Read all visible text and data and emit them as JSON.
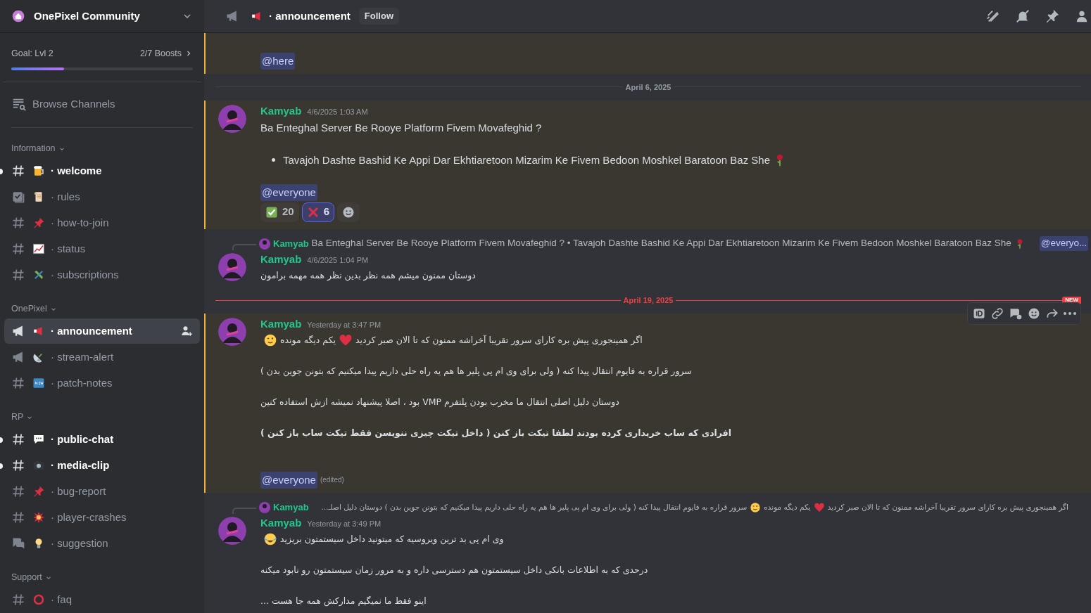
{
  "server": {
    "name": "OnePixel Community"
  },
  "boost": {
    "goal": "Goal: Lvl 2",
    "count": "2/7 Boosts",
    "level": 0.29
  },
  "browse": "Browse Channels",
  "categories": [
    {
      "name": "Information",
      "channels": [
        {
          "name": "· welcome",
          "kind": "text",
          "emoji": {
            "kind": "beer"
          },
          "unread": true,
          "selected": false
        },
        {
          "name": "· rules",
          "kind": "rules",
          "emoji": {
            "kind": "scroll"
          },
          "unread": false,
          "selected": false
        },
        {
          "name": "· how-to-join",
          "kind": "text",
          "emoji": {
            "kind": "pin"
          },
          "unread": false,
          "selected": false
        },
        {
          "name": "· status",
          "kind": "text",
          "emoji": {
            "kind": "chart"
          },
          "unread": false,
          "selected": false
        },
        {
          "name": "· subscriptions",
          "kind": "text",
          "emoji": {
            "kind": "tools"
          },
          "unread": false,
          "selected": false
        }
      ]
    },
    {
      "name": "OnePixel",
      "channels": [
        {
          "name": "· announcement",
          "kind": "announcement",
          "emoji": {
            "kind": "megaphone"
          },
          "unread": true,
          "selected": true
        },
        {
          "name": "· stream-alert",
          "kind": "announcement",
          "emoji": {
            "kind": "satellite"
          },
          "unread": false,
          "selected": false
        },
        {
          "name": "· patch-notes",
          "kind": "text",
          "emoji": {
            "kind": "new"
          },
          "unread": false,
          "selected": false
        }
      ]
    },
    {
      "name": "RP",
      "channels": [
        {
          "name": "· public-chat",
          "kind": "text",
          "emoji": {
            "kind": "speech"
          },
          "unread": true,
          "selected": false
        },
        {
          "name": "· media-clip",
          "kind": "text",
          "emoji": {
            "kind": "camera"
          },
          "unread": true,
          "selected": false
        },
        {
          "name": "· bug-report",
          "kind": "text",
          "emoji": {
            "kind": "pin"
          },
          "unread": false,
          "selected": false
        },
        {
          "name": "· player-crashes",
          "kind": "text",
          "emoji": {
            "kind": "boom"
          },
          "unread": false,
          "selected": false
        },
        {
          "name": "· suggestion",
          "kind": "forum",
          "emoji": {
            "kind": "bulb"
          },
          "unread": false,
          "selected": false
        }
      ]
    },
    {
      "name": "Support",
      "channels": [
        {
          "name": "· faq",
          "kind": "text",
          "emoji": {
            "kind": "ring"
          },
          "unread": false,
          "selected": false
        }
      ]
    }
  ],
  "header": {
    "channel": "· announcement",
    "kind": "announcement",
    "emoji": {
      "kind": "megaphone"
    },
    "follow": "Follow"
  },
  "feed": [
    {
      "kind": "message",
      "highlighted": true,
      "lines": [
        {
          "kind": "mention",
          "text": "@here"
        }
      ]
    },
    {
      "kind": "divider",
      "date": "April 6, 2025",
      "new": false
    },
    {
      "kind": "message",
      "highlighted": true,
      "author": "Kamyab",
      "time": "4/6/2025 1:03 AM",
      "lines": [
        {
          "kind": "text",
          "parts": [
            {
              "kind": "text",
              "text": "Ba Enteghal Server Be Rooye Platform Fivem Movafeghid ?"
            }
          ]
        },
        {
          "kind": "blank"
        },
        {
          "kind": "bullet",
          "parts": [
            {
              "kind": "text",
              "text": "Tavajoh Dashte Bashid Ke Appi Dar Ekhtiaretoon Mizarim Ke Fivem Bedoon Moshkel Baratoon Baz She"
            },
            {
              "kind": "rose"
            }
          ]
        },
        {
          "kind": "blank"
        },
        {
          "kind": "mention",
          "text": "@everyone"
        }
      ],
      "reactions": [
        {
          "emoji": {
            "kind": "check"
          },
          "count": "20",
          "selected": false
        },
        {
          "emoji": {
            "kind": "cross"
          },
          "count": "6",
          "selected": true
        }
      ]
    },
    {
      "kind": "message",
      "highlighted": false,
      "author": "Kamyab",
      "time": "4/6/2025 1:04 PM",
      "reply": {
        "author": "Kamyab",
        "rtl": false,
        "parts": [
          {
            "kind": "text",
            "text": "Ba Enteghal Server Be Rooye Platform Fivem Movafeghid ? • Tavajoh Dashte Bashid Ke Appi Dar Ekhtiaretoon Mizarim Ke Fivem Bedoon Moshkel Baratoon Baz She"
          },
          {
            "kind": "rose"
          }
        ],
        "mention": "@everyo..."
      },
      "lines": [
        {
          "kind": "rtl",
          "parts": [
            {
              "kind": "text",
              "text": "دوستان ممنون میشم همه نظر بدین نظر همه مهمه برامون"
            }
          ]
        }
      ]
    },
    {
      "kind": "divider",
      "date": "April 19, 2025",
      "new": true,
      "badge": "NEW"
    },
    {
      "kind": "message",
      "highlighted": true,
      "hovered": true,
      "author": "Kamyab",
      "time": "Yesterday at 3:47 PM",
      "lines": [
        {
          "kind": "rtl",
          "parts": [
            {
              "kind": "text",
              "text": "اگر همینجوری پیش بره کارای سرور تقریبا آخراشه ممنون که تا الان صبر کردید"
            },
            {
              "kind": "heart"
            },
            {
              "kind": "text",
              "text": "یکم دیگه مونده"
            },
            {
              "kind": "wink"
            }
          ]
        },
        {
          "kind": "blank"
        },
        {
          "kind": "rtl",
          "parts": [
            {
              "kind": "text",
              "text": "سرور قراره به فایوم انتقال پیدا کنه ( ولی برای وی ام پی پلیر ها هم یه راه حلی داریم پیدا میکنیم که بتونن جوین بدن )"
            }
          ]
        },
        {
          "kind": "blank"
        },
        {
          "kind": "rtl",
          "parts": [
            {
              "kind": "text",
              "text": "دوستان دلیل اصلی انتقال ما مخرب بودن پلتفرم VMP بود ، اصلا پیشنهاد نمیشه ازش استفاده کنین"
            }
          ]
        },
        {
          "kind": "blank"
        },
        {
          "kind": "rtl-bold",
          "parts": [
            {
              "kind": "text",
              "text": "افرادی که ساب خریداری کرده بودند لطفا تیکت باز کنن ( داخل تیکت چیزی ننویسن فقط تیکت ساب باز کنن )"
            }
          ]
        },
        {
          "kind": "blank"
        },
        {
          "kind": "blank"
        },
        {
          "kind": "mention",
          "text": "@everyone",
          "edited": "(edited)"
        }
      ]
    },
    {
      "kind": "message",
      "highlighted": false,
      "author": "Kamyab",
      "time": "Yesterday at 3:49 PM",
      "reply": {
        "author": "Kamyab",
        "rtl": true,
        "parts": [
          {
            "kind": "text",
            "text": "اگر همینجوری پیش بره کارای سرور تقریبا آخراشه ممنون که تا الان صبر کردید"
          },
          {
            "kind": "heart"
          },
          {
            "kind": "text",
            "text": "یکم دیگه مونده"
          },
          {
            "kind": "wink"
          },
          {
            "kind": "text",
            "text": "سرور قراره به فایوم انتقال پیدا کنه ( ولی برای وی ام پی پلیر ها هم یه راه حلی داریم پیدا میکنیم که بتونن جوین بدن ) دوستان دلیل اصلـ..."
          }
        ]
      },
      "lines": [
        {
          "kind": "rtl",
          "parts": [
            {
              "kind": "text",
              "text": "وی ام پی بد ترین ویروسیه که میتونید داخل سیستمتون بریزید"
            },
            {
              "kind": "laugh"
            }
          ]
        },
        {
          "kind": "blank"
        },
        {
          "kind": "rtl",
          "parts": [
            {
              "kind": "text",
              "text": "درحدی که به اطلاعات بانکی داخل سیستمتون هم دسترسی داره و به مرور زمان سیستمتون رو نابود میکنه"
            }
          ]
        },
        {
          "kind": "blank"
        },
        {
          "kind": "rtl",
          "parts": [
            {
              "kind": "text",
              "text": "اینو فقط ما نمیگیم مدارکش همه جا هست ..."
            }
          ]
        }
      ]
    }
  ]
}
